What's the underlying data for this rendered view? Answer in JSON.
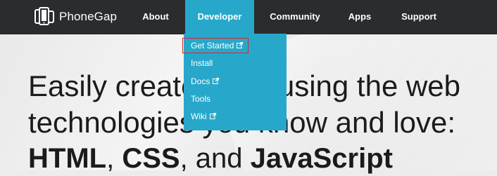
{
  "brand": {
    "name": "PhoneGap",
    "logo_icon": "phonegap-devices-icon"
  },
  "nav": {
    "about": "About",
    "developer": "Developer",
    "community": "Community",
    "apps": "Apps",
    "support": "Support"
  },
  "dropdown": {
    "items": [
      {
        "label": "Get Started",
        "external": true
      },
      {
        "label": "Install",
        "external": false
      },
      {
        "label": "Docs",
        "external": true
      },
      {
        "label": "Tools",
        "external": false
      },
      {
        "label": "Wiki",
        "external": true
      }
    ],
    "highlighted": "Get Started"
  },
  "hero": {
    "line1": "Easily create apps using the web",
    "line2": "technologies you know and love:",
    "line3": {
      "html": "HTML",
      "sep1": ", ",
      "css": "CSS",
      "sep2": ", and ",
      "js": "JavaScript"
    }
  },
  "colors": {
    "navbar": "#2a2c2e",
    "accent": "#27a8cb",
    "highlight_border": "#d9262c",
    "hero_text": "#1b1b1b"
  }
}
